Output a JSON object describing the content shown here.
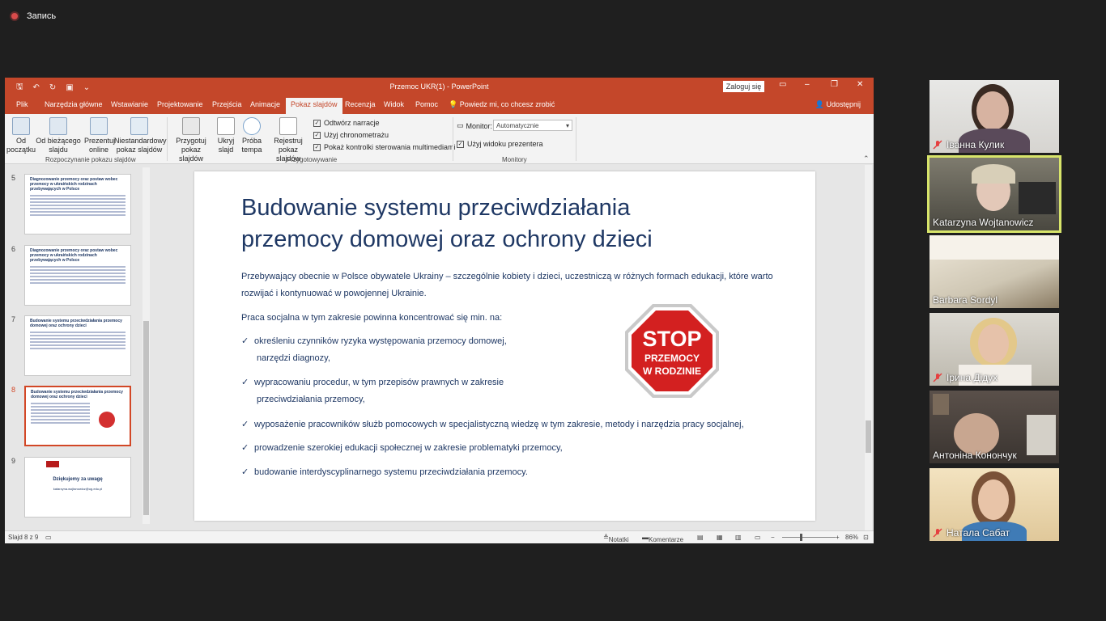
{
  "meeting": {
    "recording_label": "Запись"
  },
  "window": {
    "title": "Przemoc UKR(1)  -  PowerPoint",
    "login_label": "Zaloguj się"
  },
  "tabs": [
    "Plik",
    "Narzędzia główne",
    "Wstawianie",
    "Projektowanie",
    "Przejścia",
    "Animacje",
    "Pokaz slajdów",
    "Recenzja",
    "Widok",
    "Pomoc"
  ],
  "tell_me": "Powiedz mi, co chcesz zrobić",
  "share_label": "Udostępnij",
  "ribbon": {
    "from_start": [
      "Od",
      "początku"
    ],
    "from_current": [
      "Od bieżącego",
      "slajdu"
    ],
    "present_online": [
      "Prezentuj",
      "online"
    ],
    "custom_show": [
      "Niestandardowy",
      "pokaz slajdów"
    ],
    "group_start": "Rozpoczynanie pokazu slajdów",
    "setup": [
      "Przygotuj",
      "pokaz slajdów"
    ],
    "hide": [
      "Ukryj",
      "slajd"
    ],
    "rehearse": [
      "Próba",
      "tempa"
    ],
    "record": [
      "Rejestruj pokaz",
      "slajdów"
    ],
    "group_setup": "Przygotowywanie",
    "chk_narration": "Odtwórz narracje",
    "chk_timings": "Użyj chronometrażu",
    "chk_media": "Pokaż kontrolki sterowania multimediami",
    "monitor_label": "Monitor:",
    "monitor_value": "Automatycznie",
    "presenter_view": "Użyj widoku prezentera",
    "group_monitors": "Monitory"
  },
  "thumbnails": [
    {
      "num": "5",
      "title": "Diagnozowanie przemocy oraz postaw wobec przemocy w ukraińskich rodzinach przebywających w Polsce"
    },
    {
      "num": "6",
      "title": "Diagnozowanie przemocy oraz postaw wobec przemocy w ukraińskich rodzinach przebywających w Polsce"
    },
    {
      "num": "7",
      "title": "Budowanie systemu przeciwdziałania przemocy domowej oraz ochrony dzieci"
    },
    {
      "num": "8",
      "title": "Budowanie systemu przeciwdziałania przemocy domowej oraz ochrony dzieci"
    },
    {
      "num": "9",
      "title": "Dziękujemy za uwagę",
      "email": "katarzyna.wojtanowicz@ug.edu.pl"
    }
  ],
  "slide": {
    "title_line1": "Budowanie systemu przeciwdziałania",
    "title_line2": "przemocy domowej oraz ochrony  dzieci",
    "para1_line1": "Przebywający obecnie w Polsce obywatele Ukrainy – szczególnie kobiety i dzieci, uczestniczą w różnych formach edukacji, które warto",
    "para1_line2": "rozwijać i kontynuować w  powojennej Ukrainie.",
    "para2": "Praca socjalna w tym zakresie powinna koncentrować się  min. na:",
    "b1_l1": "określeniu czynników ryzyka występowania przemocy  domowej,",
    "b1_l2": "narzędzi diagnozy,",
    "b2_l1": "wypracowaniu procedur, w tym przepisów prawnych w zakresie",
    "b2_l2": "przeciwdziałania przemocy,",
    "b3": "wyposażenie pracowników służb pomocowych w specjalistyczną wiedzę w tym zakresie, metody i narzędzia pracy socjalnej,",
    "b4": "prowadzenie szerokiej edukacji społecznej w zakresie problematyki przemocy,",
    "b5": "budowanie interdyscyplinarnego systemu przeciwdziałania przemocy.",
    "check": "✓",
    "stop_big": "STOP",
    "stop_l2": "PRZEMOCY",
    "stop_l3": "W RODZINIE"
  },
  "statusbar": {
    "slide_of": "Slajd 8 z 9",
    "notes": "Notatki",
    "comments": "Komentarze",
    "zoom": "86%"
  },
  "participants": [
    {
      "name": "Іванна Кулик",
      "muted": true
    },
    {
      "name": "Katarzyna Wojtanowicz",
      "muted": false
    },
    {
      "name": "Barbara Sordyl",
      "muted": false
    },
    {
      "name": "Ірина Дідух",
      "muted": true
    },
    {
      "name": "Антоніна Конончук",
      "muted": false
    },
    {
      "name": "Натала Сабат",
      "muted": true
    }
  ],
  "colors": {
    "ppt_accent": "#c4472a",
    "slide_text": "#1f3864",
    "speaking": "#d7e46a"
  }
}
